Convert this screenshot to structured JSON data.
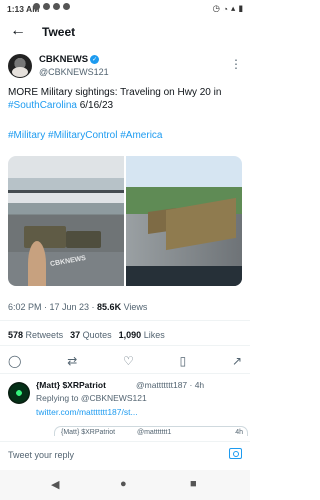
{
  "status": {
    "time": "1:13 AM"
  },
  "header": {
    "title": "Tweet"
  },
  "tweet": {
    "author_name": "CBKNEWS",
    "author_handle": "@CBKNEWS121",
    "text_before_link": "MORE Military sightings: Traveling on Hwy 20 in ",
    "hashtag_inline": "#SouthCarolina",
    "text_after_link": " 6/16/23",
    "hashtags": "#Military #MilitaryControl #America",
    "image_watermark": "CBKNEWS",
    "meta_time": "6:02 PM · 17 Jun 23 · ",
    "views": "85.6K",
    "views_label": " Views",
    "retweets": "578",
    "retweets_label": "Retweets",
    "quotes": "37",
    "quotes_label": "Quotes",
    "likes": "1,090",
    "likes_label": "Likes"
  },
  "reply": {
    "name": "{Matt} $XRPatriot",
    "handle_time": "@mattttttt187 · 4h",
    "replying_to": "Replying to @CBKNEWS121",
    "link": "twitter.com/mattttttt187/st...",
    "quote_name": "{Matt} $XRPatriot",
    "quote_handle": "@mattttttt1",
    "quote_time": "4h"
  },
  "composer": {
    "placeholder": "Tweet your reply"
  }
}
